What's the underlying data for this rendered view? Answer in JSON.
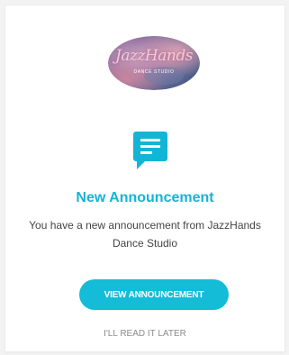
{
  "logo": {
    "text": "JazzHands",
    "subtext": "DANCE STUDIO",
    "icon": "jazzhands-logo"
  },
  "notification": {
    "icon": "message-icon",
    "title": "New Announcement",
    "body": "You have a new announcement from JazzHands Dance Studio"
  },
  "actions": {
    "view_label": "VIEW ANNOUNCEMENT",
    "later_label": "I'LL READ IT LATER"
  },
  "colors": {
    "accent": "#13b5d6",
    "button": "#14bcd8",
    "text": "#444444",
    "muted": "#8c8c8c"
  }
}
